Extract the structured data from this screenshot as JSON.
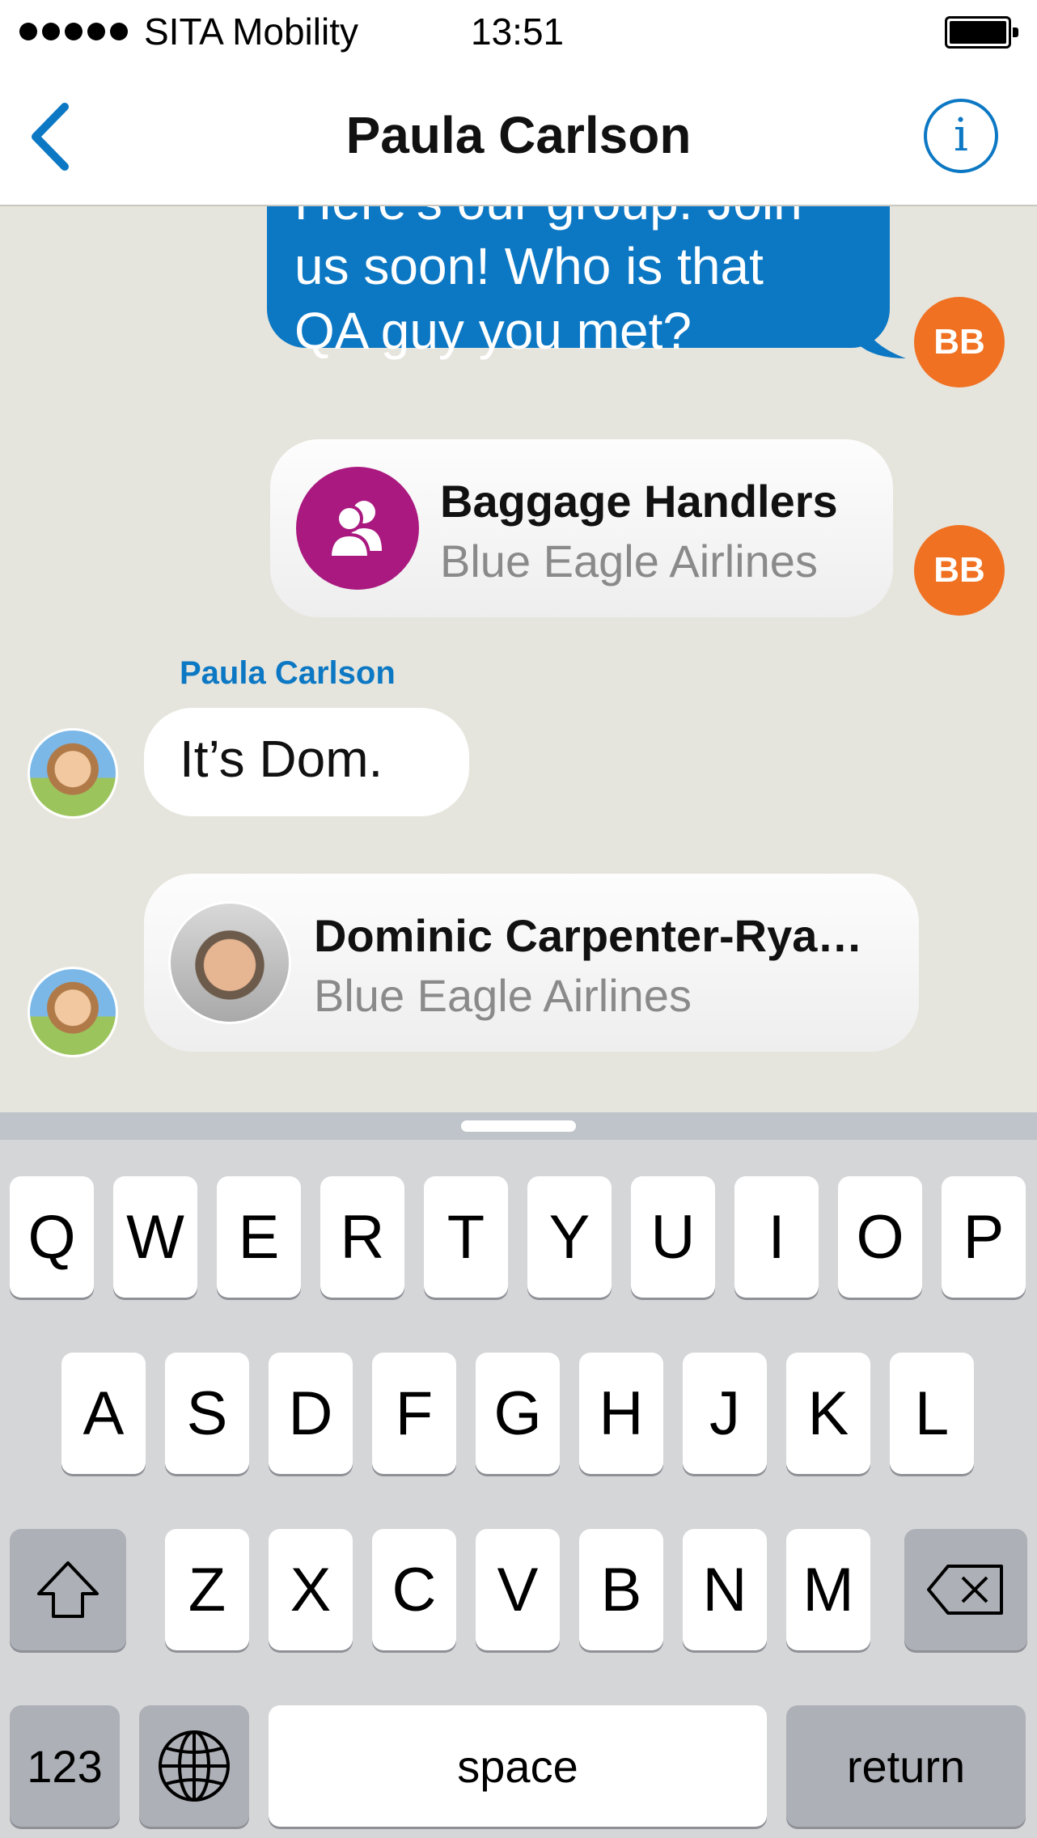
{
  "status_bar": {
    "carrier": "SITA Mobility",
    "time": "13:51"
  },
  "nav": {
    "title": "Paula Carlson",
    "back_icon": "chevron-left-icon",
    "info_icon": "info-icon"
  },
  "colors": {
    "accent": "#0c78c4",
    "avatar_orange": "#f07122",
    "group_purple": "#a9197f"
  },
  "chat": {
    "outgoing_message": {
      "lines": [
        "Here's our group. Join",
        "us soon! Who is that",
        "QA guy you met?"
      ]
    },
    "avatar_initials": "BB",
    "group_card": {
      "title": "Baggage Handlers",
      "subtitle": "Blue Eagle Airlines"
    },
    "incoming_sender": "Paula Carlson",
    "incoming_message": "It’s Dom.",
    "contact_card": {
      "title": "Dominic Carpenter-Rya…",
      "subtitle": "Blue Eagle Airlines"
    }
  },
  "keyboard": {
    "row1": [
      "Q",
      "W",
      "E",
      "R",
      "T",
      "Y",
      "U",
      "I",
      "O",
      "P"
    ],
    "row2": [
      "A",
      "S",
      "D",
      "F",
      "G",
      "H",
      "J",
      "K",
      "L"
    ],
    "row3": [
      "Z",
      "X",
      "C",
      "V",
      "B",
      "N",
      "M"
    ],
    "numbers_label": "123",
    "space_label": "space",
    "return_label": "return"
  }
}
